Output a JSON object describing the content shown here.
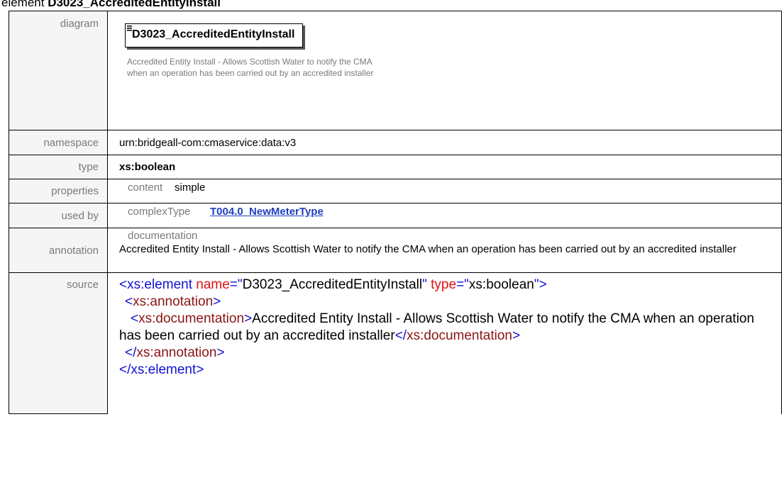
{
  "title": {
    "prefix": "element ",
    "name": "D3023_AccreditedEntityInstall"
  },
  "rows": {
    "diagram": {
      "label": "diagram",
      "box_text": "D3023_AccreditedEntityInstall",
      "description": "Accredited Entity Install - Allows Scottish Water to notify the CMA when an operation has been carried out by an accredited installer"
    },
    "namespace": {
      "label": "namespace",
      "value": "urn:bridgeall-com:cmaservice:data:v3"
    },
    "type": {
      "label": "type",
      "value": "xs:boolean"
    },
    "properties": {
      "label": "properties",
      "key": "content",
      "value": "simple"
    },
    "used_by": {
      "label": "used by",
      "key": "complexType",
      "link": "T004.0_NewMeterType"
    },
    "annotation": {
      "label": "annotation",
      "key": "documentation",
      "value": "Accredited Entity Install - Allows Scottish Water to notify the CMA when an operation has been carried out by an accredited installer"
    },
    "source": {
      "label": "source",
      "element_tag": "xs:element",
      "name_attr": "name",
      "name_value": "D3023_AccreditedEntityInstall",
      "type_attr": "type",
      "type_value": "xs:boolean",
      "annotation_tag": "xs:annotation",
      "documentation_tag": "xs:documentation",
      "documentation_text": "Accredited Entity Install - Allows Scottish Water to notify the CMA when an operation has been carried out by an accredited installer"
    }
  }
}
